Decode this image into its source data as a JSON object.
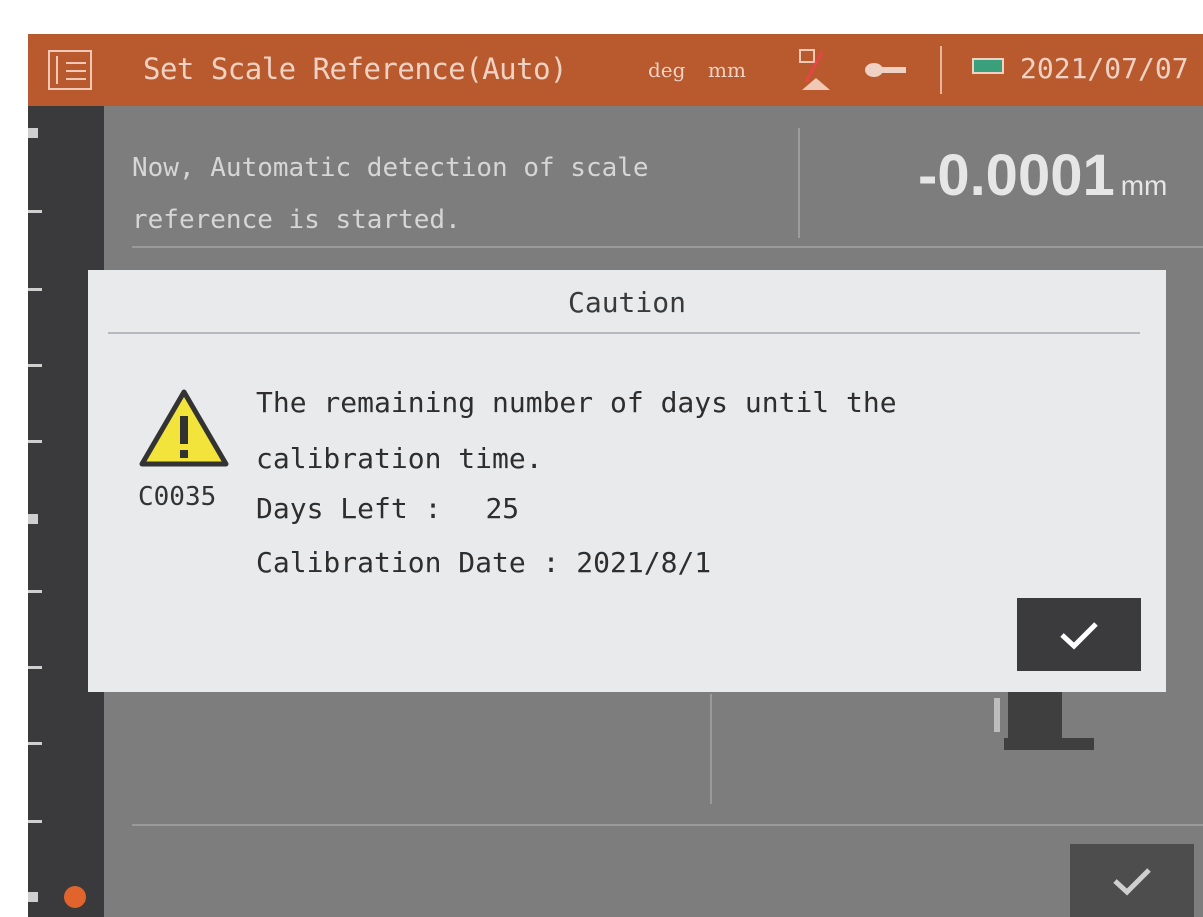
{
  "titlebar": {
    "title": "Set Scale Reference(Auto)",
    "unit_angle": "deg",
    "unit_length": "mm",
    "date": "2021/07/07",
    "accent_color": "#b85a2e"
  },
  "sidebar": {
    "icons": [
      "menu-icon",
      "indicator-dot"
    ]
  },
  "main": {
    "message_line1": "Now, Automatic detection of scale",
    "message_line2": "reference is started.",
    "value": "-0.0001",
    "value_unit": "mm"
  },
  "dialog": {
    "title": "Caution",
    "code": "C0035",
    "line1": "The remaining number of days until the",
    "line2": "calibration time.",
    "days_left_label": "Days Left :",
    "days_left_value": "25",
    "calibration_date_label": "Calibration Date :",
    "calibration_date_value": "2021/8/1",
    "icon": "warning-icon",
    "ok_icon": "checkmark-icon"
  }
}
